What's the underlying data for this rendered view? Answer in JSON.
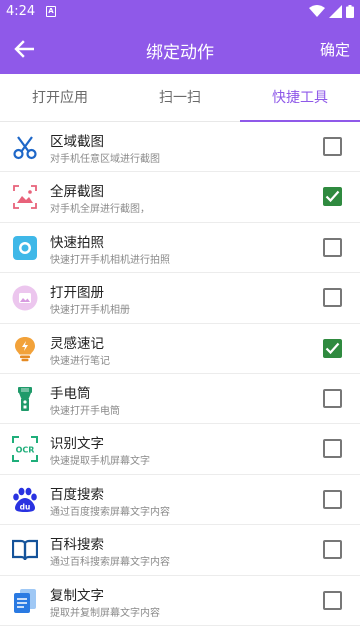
{
  "status_bar": {
    "time": "4:24",
    "notification_letter": "A"
  },
  "app_bar": {
    "title": "绑定动作",
    "confirm_label": "确定"
  },
  "tabs": [
    {
      "label": "打开应用",
      "active": false
    },
    {
      "label": "扫一扫",
      "active": false
    },
    {
      "label": "快捷工具",
      "active": true
    }
  ],
  "items": [
    {
      "icon": "scissors-icon",
      "title": "区域截图",
      "subtitle": "对手机任意区域进行截图",
      "checked": false
    },
    {
      "icon": "image-frame-icon",
      "title": "全屏截图",
      "subtitle": "对手机全屏进行截图，",
      "checked": true
    },
    {
      "icon": "camera-icon",
      "title": "快速拍照",
      "subtitle": "快速打开手机相机进行拍照",
      "checked": false
    },
    {
      "icon": "album-icon",
      "title": "打开图册",
      "subtitle": "快速打开手机相册",
      "checked": false
    },
    {
      "icon": "lightbulb-icon",
      "title": "灵感速记",
      "subtitle": "快速进行笔记",
      "checked": true
    },
    {
      "icon": "flashlight-icon",
      "title": "手电筒",
      "subtitle": "快速打开手电筒",
      "checked": false
    },
    {
      "icon": "ocr-icon",
      "title": "识别文字",
      "subtitle": "快速提取手机屏幕文字",
      "checked": false,
      "icon_text": "OCR"
    },
    {
      "icon": "baidu-paw-icon",
      "title": "百度搜索",
      "subtitle": "通过百度搜索屏幕文字内容",
      "checked": false,
      "icon_text": "du"
    },
    {
      "icon": "book-icon",
      "title": "百科搜索",
      "subtitle": "通过百科搜索屏幕文字内容",
      "checked": false
    },
    {
      "icon": "document-copy-icon",
      "title": "复制文字",
      "subtitle": "提取并复制屏幕文字内容",
      "checked": false
    }
  ],
  "colors": {
    "accent": "#8f59e9",
    "checked": "#2f8a3f"
  }
}
